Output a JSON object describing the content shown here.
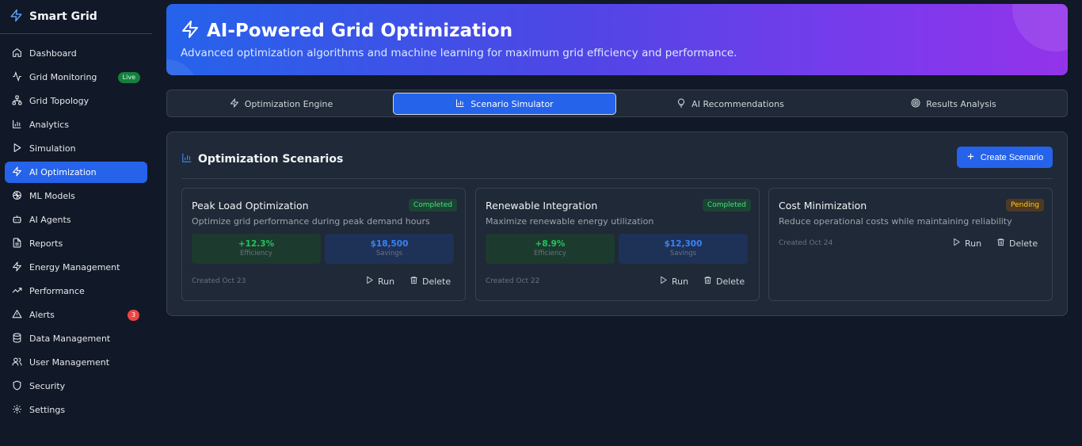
{
  "brand": {
    "name": "Smart Grid",
    "icon": "zap-icon"
  },
  "sidebar": {
    "items": [
      {
        "label": "Dashboard",
        "icon": "home-icon"
      },
      {
        "label": "Grid Monitoring",
        "icon": "activity-icon",
        "badge": "Live"
      },
      {
        "label": "Grid Topology",
        "icon": "network-icon"
      },
      {
        "label": "Analytics",
        "icon": "bar-chart-icon"
      },
      {
        "label": "Simulation",
        "icon": "play-icon"
      },
      {
        "label": "AI Optimization",
        "icon": "zap-icon",
        "active": true
      },
      {
        "label": "ML Models",
        "icon": "brain-icon"
      },
      {
        "label": "AI Agents",
        "icon": "bot-icon"
      },
      {
        "label": "Reports",
        "icon": "file-icon"
      },
      {
        "label": "Energy Management",
        "icon": "zap-icon"
      },
      {
        "label": "Performance",
        "icon": "trending-up-icon"
      },
      {
        "label": "Alerts",
        "icon": "alert-triangle-icon",
        "count": "3"
      },
      {
        "label": "Data Management",
        "icon": "database-icon"
      },
      {
        "label": "User Management",
        "icon": "users-icon"
      },
      {
        "label": "Security",
        "icon": "shield-icon"
      },
      {
        "label": "Settings",
        "icon": "gear-icon"
      }
    ]
  },
  "hero": {
    "title": "AI-Powered Grid Optimization",
    "subtitle": "Advanced optimization algorithms and machine learning for maximum grid efficiency and performance."
  },
  "tabs": [
    {
      "label": "Optimization Engine",
      "icon": "zap-icon"
    },
    {
      "label": "Scenario Simulator",
      "icon": "bar-chart-icon",
      "active": true
    },
    {
      "label": "AI Recommendations",
      "icon": "lightbulb-icon"
    },
    {
      "label": "Results Analysis",
      "icon": "target-icon"
    }
  ],
  "panel": {
    "title": "Optimization Scenarios",
    "create_label": "Create Scenario",
    "run_label": "Run",
    "delete_label": "Delete",
    "efficiency_label": "Efficiency",
    "savings_label": "Savings"
  },
  "scenarios": [
    {
      "title": "Peak Load Optimization",
      "description": "Optimize grid performance during peak demand hours",
      "status": "Completed",
      "efficiency": "+12.3%",
      "savings": "$18,500",
      "created": "Created Oct 23"
    },
    {
      "title": "Renewable Integration",
      "description": "Maximize renewable energy utilization",
      "status": "Completed",
      "efficiency": "+8.9%",
      "savings": "$12,300",
      "created": "Created Oct 22"
    },
    {
      "title": "Cost Minimization",
      "description": "Reduce operational costs while maintaining reliability",
      "status": "Pending",
      "created": "Created Oct 24"
    }
  ],
  "colors": {
    "accent": "#2563eb",
    "background": "#111827",
    "card": "#1f2937",
    "success": "#22c55e",
    "warning": "#facc15",
    "danger": "#ef4444"
  }
}
